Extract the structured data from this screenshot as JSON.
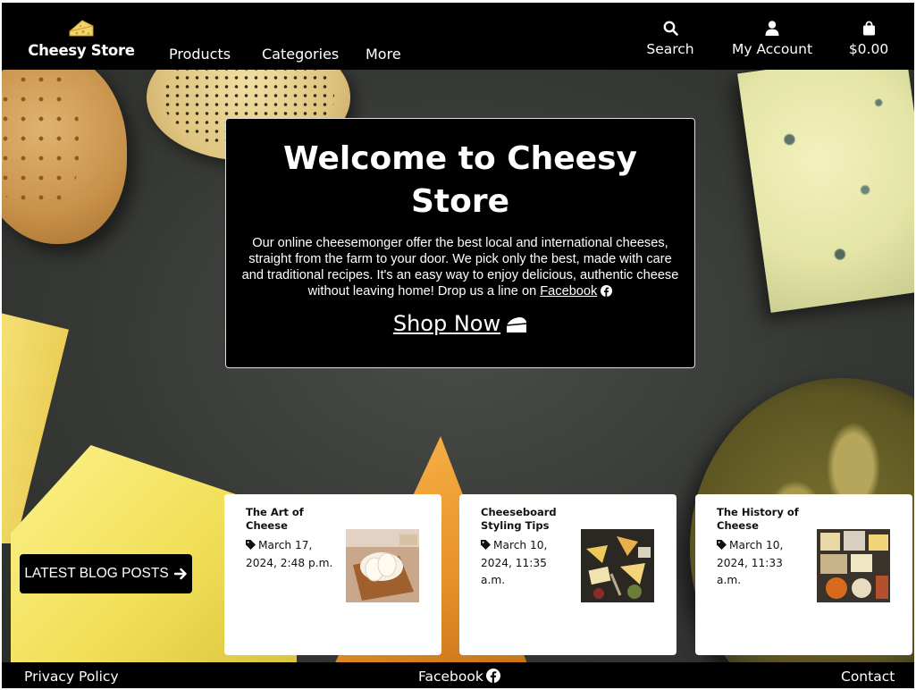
{
  "header": {
    "brand_name": "Cheesy Store",
    "nav": [
      "Products",
      "Categories",
      "More"
    ],
    "search_label": "Search",
    "account_label": "My Account",
    "cart_total": "$0.00"
  },
  "welcome": {
    "title": "Welcome to Cheesy Store",
    "text": "Our online cheesemonger offer the best local and international cheeses, straight from the farm to your door. We pick only the best, made with care and traditional recipes. It's an easy way to enjoy delicious, authentic cheese without leaving home! Drop us a line on",
    "facebook_link": "Facebook",
    "shop_now": "Shop Now"
  },
  "blog": {
    "button_label": "LATEST BLOG POSTS",
    "posts": [
      {
        "title": "The Art of Cheese",
        "date": "March 17, 2024, 2:48 p.m."
      },
      {
        "title": "Cheeseboard Styling Tips",
        "date": "March 10, 2024, 11:35 a.m."
      },
      {
        "title": "The History of Cheese",
        "date": "March 10, 2024, 11:33 a.m."
      }
    ]
  },
  "footer": {
    "privacy": "Privacy Policy",
    "facebook": "Facebook",
    "contact": "Contact"
  },
  "colors": {
    "nav_bg": "#000000",
    "text_light": "#ffffff",
    "card_bg": "#ffffff"
  }
}
